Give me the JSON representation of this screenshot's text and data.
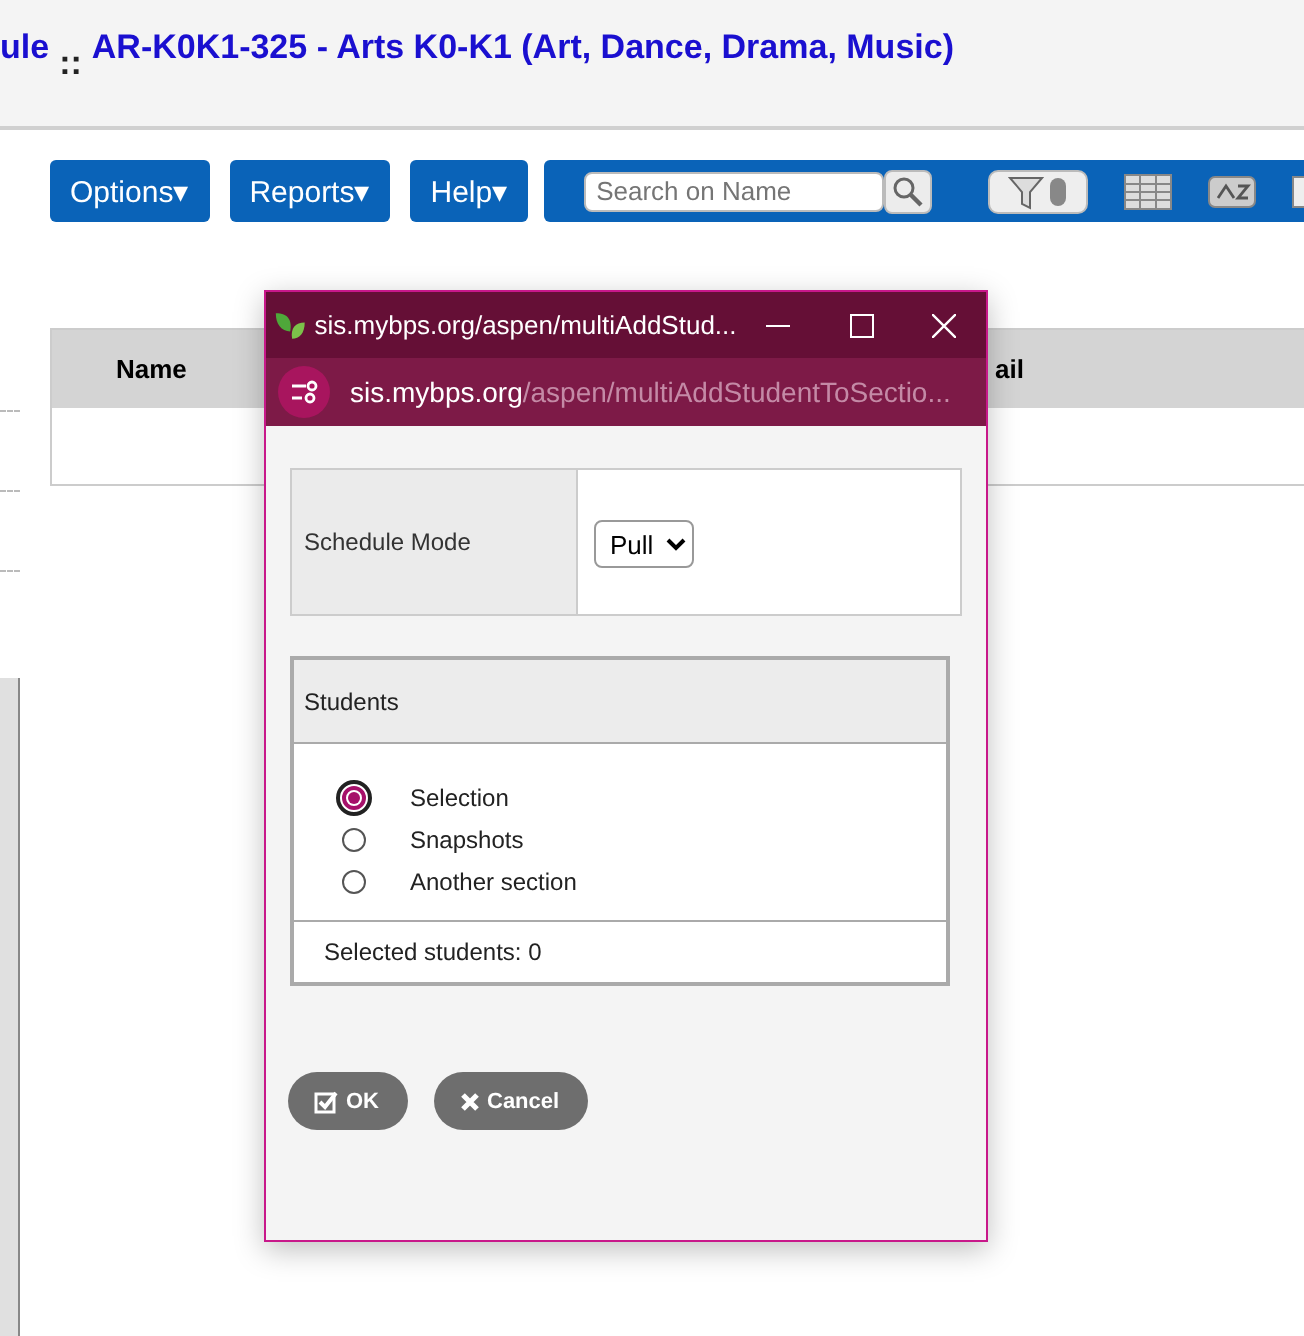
{
  "header": {
    "title_cut": "ule",
    "separator": "::",
    "title": "AR-K0K1-325 - Arts K0-K1 (Art, Dance, Drama, Music)"
  },
  "menus": [
    {
      "label": "Options",
      "caret": "▾"
    },
    {
      "label": "Reports",
      "caret": "▾"
    },
    {
      "label": "Help",
      "caret": "▾"
    }
  ],
  "toolbar": {
    "search": {
      "placeholder": "Search on Name"
    },
    "filter_toggle": {
      "on": false
    }
  },
  "table": {
    "columns": [
      "Name",
      "ail"
    ]
  },
  "popup": {
    "window_title": "sis.mybps.org/aspen/multiAddStud...",
    "address_host": "sis.mybps.org",
    "address_path": "/aspen/multiAddStudentToSectio...",
    "schedule_mode": {
      "label": "Schedule Mode",
      "value": "Pull"
    },
    "students": {
      "heading": "Students",
      "options": [
        {
          "label": "Selection",
          "selected": true
        },
        {
          "label": "Snapshots",
          "selected": false
        },
        {
          "label": "Another section",
          "selected": false
        }
      ],
      "footer": "Selected students:  0"
    },
    "buttons": [
      {
        "kind": "ok",
        "label": "OK"
      },
      {
        "kind": "cancel",
        "label": "Cancel"
      }
    ]
  }
}
